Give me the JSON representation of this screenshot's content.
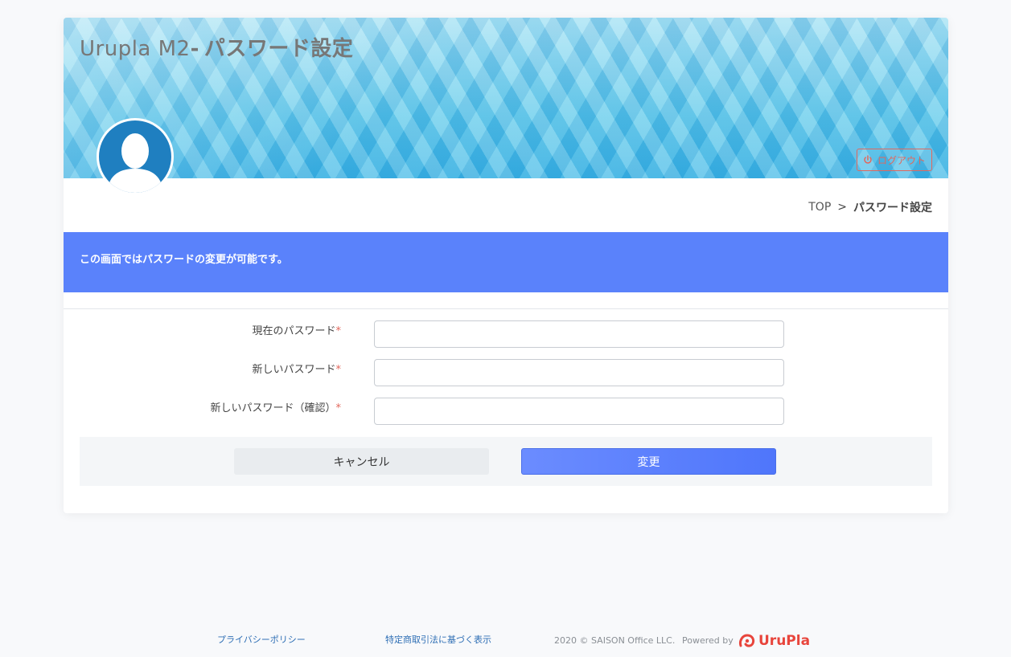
{
  "header": {
    "app_name": "Urupla M2",
    "separator": "-",
    "page_name": "パスワード設定",
    "logout_label": "ログアウト"
  },
  "breadcrumb": {
    "top": "TOP",
    "sep": ">",
    "current": "パスワード設定"
  },
  "notice": {
    "text": "この画面ではパスワードの変更が可能です。"
  },
  "form": {
    "fields": [
      {
        "label": "現在のパスワード",
        "required_mark": "*",
        "value": ""
      },
      {
        "label": "新しいパスワード",
        "required_mark": "*",
        "value": ""
      },
      {
        "label": "新しいパスワード（確認）",
        "required_mark": "*",
        "value": ""
      }
    ],
    "cancel_label": "キャンセル",
    "submit_label": "変更"
  },
  "footer": {
    "privacy": "プライバシーポリシー",
    "tokutei": "特定商取引法に基づく表示",
    "copyright": "2020 © SAISON Office LLC.",
    "powered_by": "Powered by",
    "brand": "UruPla"
  },
  "colors": {
    "accent": "#5a82fb",
    "danger": "#e2675c",
    "brand": "#e8453c"
  },
  "icons": {
    "logout": "power-icon",
    "avatar": "user-silhouette-icon",
    "brand": "urupla-logo-icon"
  }
}
